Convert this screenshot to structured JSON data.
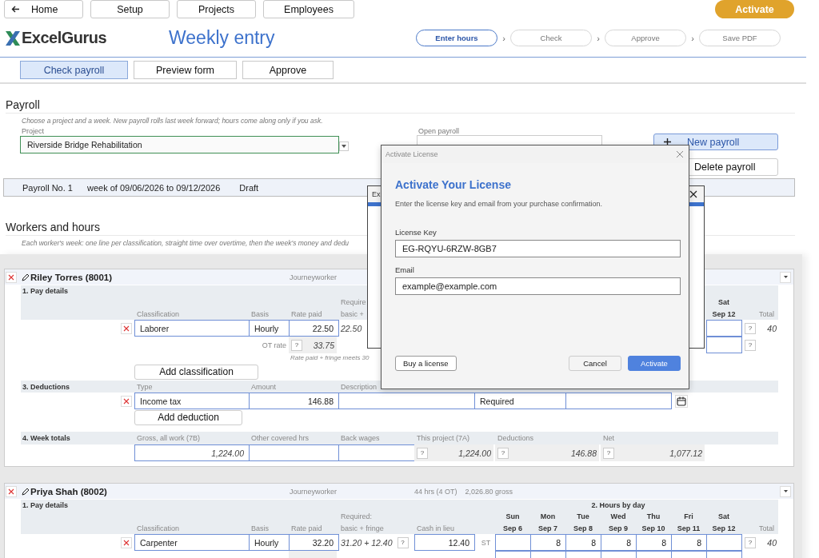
{
  "nav": {
    "buttons": [
      "Home",
      "Setup",
      "Projects",
      "Employees"
    ],
    "activate": "Activate"
  },
  "header": {
    "logo": "ExcelGurus",
    "title": "Weekly entry",
    "steps": [
      {
        "label": "Enter hours",
        "selected": true
      },
      {
        "label": "Check",
        "selected": false
      },
      {
        "label": "Approve",
        "selected": false
      },
      {
        "label": "Save PDF",
        "selected": false
      }
    ],
    "separator": "›"
  },
  "tabs": [
    {
      "label": "Check payroll",
      "selected": true
    },
    {
      "label": "Preview form",
      "selected": false
    },
    {
      "label": "Approve",
      "selected": false
    }
  ],
  "payroll": {
    "heading": "Payroll",
    "hint": "Choose a project and a week. New payroll rolls last week forward; hours come along only if you ask.",
    "project_label": "Project",
    "project": "Riverside Bridge Rehabilitation",
    "open_label": "Open payroll",
    "new_button": "New payroll",
    "delete_button": "Delete payroll",
    "bar": [
      "Payroll No. 1",
      "week of 09/06/2026 to 09/12/2026",
      "Draft"
    ]
  },
  "workers_section": {
    "heading": "Workers and hours",
    "hint": "Each worker's week: one line per classification, straight time over overtime, then the week's money and dedu"
  },
  "workers": [
    {
      "name": "Riley Torres (8001)",
      "role": "Journeyworker",
      "pay": {
        "title": "1. Pay details",
        "labels": {
          "classification": "Classification",
          "basis": "Basis",
          "rate": "Rate paid",
          "required_1": "Require",
          "required_2": "basic +"
        },
        "lines": [
          {
            "classification": "Laborer",
            "basis": "Hourly",
            "rate": "22.50",
            "required": "22.50",
            "ot_label": "OT rate",
            "ot_help": "?",
            "ot_rate": "33.75"
          }
        ],
        "note": "Rate paid + fringe meets 30",
        "add_button": "Add classification"
      },
      "hours": {
        "days": [
          {
            "day": "Sat",
            "date": "Sep 12"
          }
        ],
        "total_label": "Total",
        "rows": [
          {
            "kind": "st",
            "help": "?",
            "total": "40"
          },
          {
            "kind": "ot",
            "help": "?"
          }
        ]
      },
      "deductions": {
        "title": "3. Deductions",
        "labels": [
          "Type",
          "Amount",
          "Description"
        ],
        "lines": [
          {
            "type": "Income tax",
            "amount": "146.88",
            "status": "Required"
          }
        ],
        "add_button": "Add deduction"
      },
      "totals": {
        "title": "4. Week totals",
        "items": [
          {
            "label": "Gross, all work (7B)",
            "kind": "field",
            "value": "1,224.00"
          },
          {
            "label": "Other covered hrs",
            "kind": "field"
          },
          {
            "label": "Back wages",
            "kind": "field"
          },
          {
            "label": "This project (7A)",
            "kind": "readout",
            "help": "?",
            "value": "1,224.00"
          },
          {
            "label": "Deductions",
            "kind": "readout",
            "help": "?",
            "value": "146.88"
          },
          {
            "label": "Net",
            "kind": "readout",
            "help": "?",
            "value": "1,077.12"
          }
        ]
      }
    },
    {
      "name": "Priya Shah (8002)",
      "role": "Journeyworker",
      "summary": [
        "44 hrs (4 OT)",
        "2,026.80 gross"
      ],
      "pay": {
        "title": "1. Pay details",
        "labels": {
          "classification": "Classification",
          "basis": "Basis",
          "rate": "Rate paid",
          "required_1": "Required:",
          "required_2": "basic + fringe",
          "cash": "Cash in lieu"
        },
        "lines": [
          {
            "classification": "Carpenter",
            "basis": "Hourly",
            "rate": "32.20",
            "required": "31.20 + 12.40",
            "required_help": "?",
            "cash": "12.40"
          }
        ]
      },
      "hours": {
        "title": "2. Hours by day",
        "total_label": "Total",
        "days": [
          {
            "day": "Sun",
            "date": "Sep 6"
          },
          {
            "day": "Mon",
            "date": "Sep 7",
            "st": "8"
          },
          {
            "day": "Tue",
            "date": "Sep 8",
            "st": "8"
          },
          {
            "day": "Wed",
            "date": "Sep 9",
            "st": "8"
          },
          {
            "day": "Thu",
            "date": "Sep 10",
            "st": "8"
          },
          {
            "day": "Fri",
            "date": "Sep 11",
            "st": "8"
          },
          {
            "day": "Sat",
            "date": "Sep 12"
          }
        ],
        "rows": [
          {
            "kind": "st",
            "label": "ST",
            "help": "?",
            "total": "40"
          },
          {
            "kind": "ot"
          }
        ]
      }
    }
  ],
  "back_dialog": {
    "title": "Ex"
  },
  "dialog": {
    "title": "Activate License",
    "heading": "Activate Your License",
    "description": "Enter the license key and email from your purchase confirmation.",
    "key_label": "License Key",
    "key": "EG-RQYU-6RZW-8GB7",
    "email_label": "Email",
    "email": "example@example.com",
    "buy_button": "Buy a license",
    "cancel_button": "Cancel",
    "activate_button": "Activate"
  }
}
